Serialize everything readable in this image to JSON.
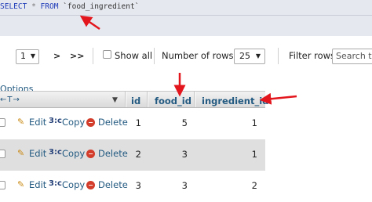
{
  "query": {
    "keyword_select": "SELECT",
    "star": "*",
    "keyword_from": "FROM",
    "table_name": "`food_ingredient`"
  },
  "navigation": {
    "page_value": "1",
    "next_label": ">",
    "last_label": ">>",
    "show_all_label": "Show all",
    "rows_label": "Number of rows:",
    "rows_value": "25",
    "filter_label": "Filter rows:",
    "filter_placeholder": "Search th"
  },
  "table": {
    "options_label": "Options",
    "resize_arrows": "←T→",
    "columns": [
      "id",
      "food_id",
      "ingredient_id"
    ],
    "actions": {
      "edit": "Edit",
      "copy": "Copy",
      "delete": "Delete"
    },
    "rows": [
      {
        "id": "1",
        "food_id": "5",
        "ingredient_id": "1"
      },
      {
        "id": "2",
        "food_id": "3",
        "ingredient_id": "1"
      },
      {
        "id": "3",
        "food_id": "3",
        "ingredient_id": "2"
      }
    ]
  },
  "colors": {
    "annotation_arrow": "#e3161d",
    "link": "#235a81",
    "alt_row": "#dfdfdf"
  },
  "icons": [
    "pencil-icon",
    "copy-icon",
    "delete-icon",
    "checkbox-icon"
  ]
}
